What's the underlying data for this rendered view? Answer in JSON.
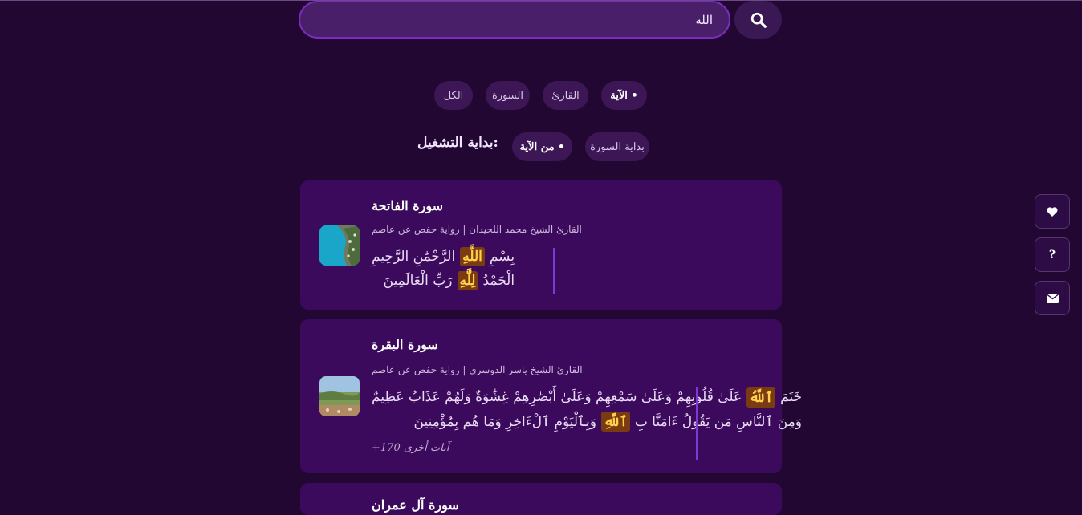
{
  "search": {
    "value": "الله",
    "placeholder": ""
  },
  "filters": [
    "الآية •",
    "القارئ",
    "السورة",
    "الكل"
  ],
  "playback": {
    "label": ":بداية التشغيل",
    "from_ayah": "من الآية •",
    "from_surah": "بداية السورة"
  },
  "results": [
    {
      "title": "سورة الفاتحة",
      "meta": "القارئ الشيخ محمد اللحيدان | رواية حفص عن عاصم",
      "lines": [
        [
          "بِسْمِ",
          "اللَّهِ",
          "الرَّحْمَٰنِ الرَّحِيمِ"
        ],
        [
          "الْحَمْدُ",
          "لِلَّهِ",
          "رَبِّ الْعَالَمِينَ"
        ]
      ]
    },
    {
      "title": "سورة البقرة",
      "meta": "القارئ الشيخ ياسر الدوسري | رواية حفص عن عاصم",
      "lines": [
        [
          "خَتَمَ",
          "ٱللَّهُ",
          "عَلَىٰ قُلُوبِهِمْ وَعَلَىٰ سَمْعِهِمْ وَعَلَىٰ أَبْصَٰرِهِمْ غِشَٰوَةٌ وَلَهُمْ عَذَابٌ عَظِيمٌ"
        ],
        [
          "وَمِنَ ٱلنَّاسِ مَن يَقُولُ ءَامَنَّا بِ",
          "ٱللَّهِ",
          "وَبِٱلْيَوْمِ ٱلْءَاخِرِ وَمَا هُم بِمُؤْمِنِينَ"
        ]
      ],
      "more": "آيات أخرى 170+"
    },
    {
      "title": "سورة آل عمران"
    }
  ],
  "side_buttons": [
    "heart-icon",
    "?",
    "mail-icon"
  ],
  "colors": {
    "background": "#220733",
    "card": "#3c0a5c",
    "accent": "#7a2cc0",
    "highlight": "#ffd24a"
  }
}
